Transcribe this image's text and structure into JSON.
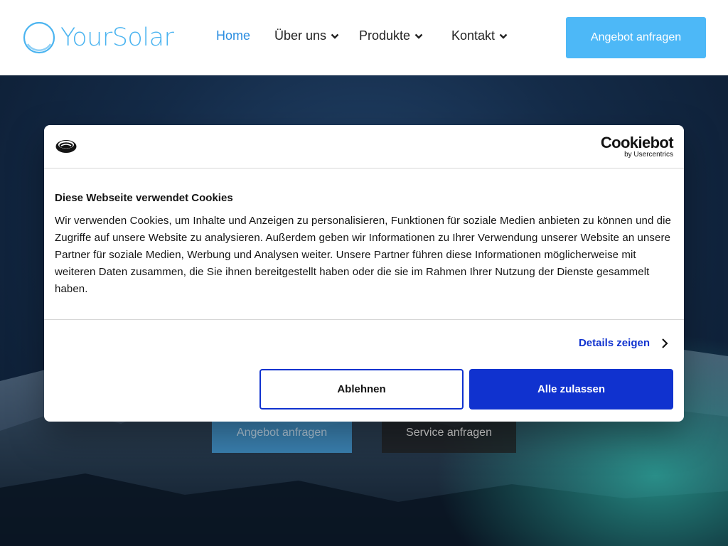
{
  "header": {
    "logo_text": "YourSolar",
    "nav": [
      {
        "label": "Home",
        "active": true,
        "dropdown": false
      },
      {
        "label": "Über uns",
        "active": false,
        "dropdown": true
      },
      {
        "label": "Produkte",
        "active": false,
        "dropdown": true
      },
      {
        "label": "Kontakt",
        "active": false,
        "dropdown": true
      }
    ],
    "cta_label": "Angebot anfragen"
  },
  "hero": {
    "primary_button": "Angebot anfragen",
    "secondary_button": "Service anfragen"
  },
  "cookie_dialog": {
    "brand_name": "Cookiebot",
    "brand_by": "by Usercentrics",
    "title": "Diese Webseite verwendet Cookies",
    "body": "Wir verwenden Cookies, um Inhalte und Anzeigen zu personalisieren, Funktionen für soziale Medien anbieten zu können und die Zugriffe auf unsere Website zu analysieren. Außerdem geben wir Informationen zu Ihrer Verwendung unserer Website an unsere Partner für soziale Medien, Werbung und Analysen weiter. Unsere Partner führen diese Informationen möglicherweise mit weiteren Daten zusammen, die Sie ihnen bereitgestellt haben oder die sie im Rahmen Ihrer Nutzung der Dienste gesammelt haben.",
    "details_label": "Details zeigen",
    "decline_label": "Ablehnen",
    "accept_label": "Alle zulassen"
  },
  "colors": {
    "brand_blue": "#4db8f7",
    "nav_active": "#2a8de0",
    "cookiebot_blue": "#1032cf"
  }
}
